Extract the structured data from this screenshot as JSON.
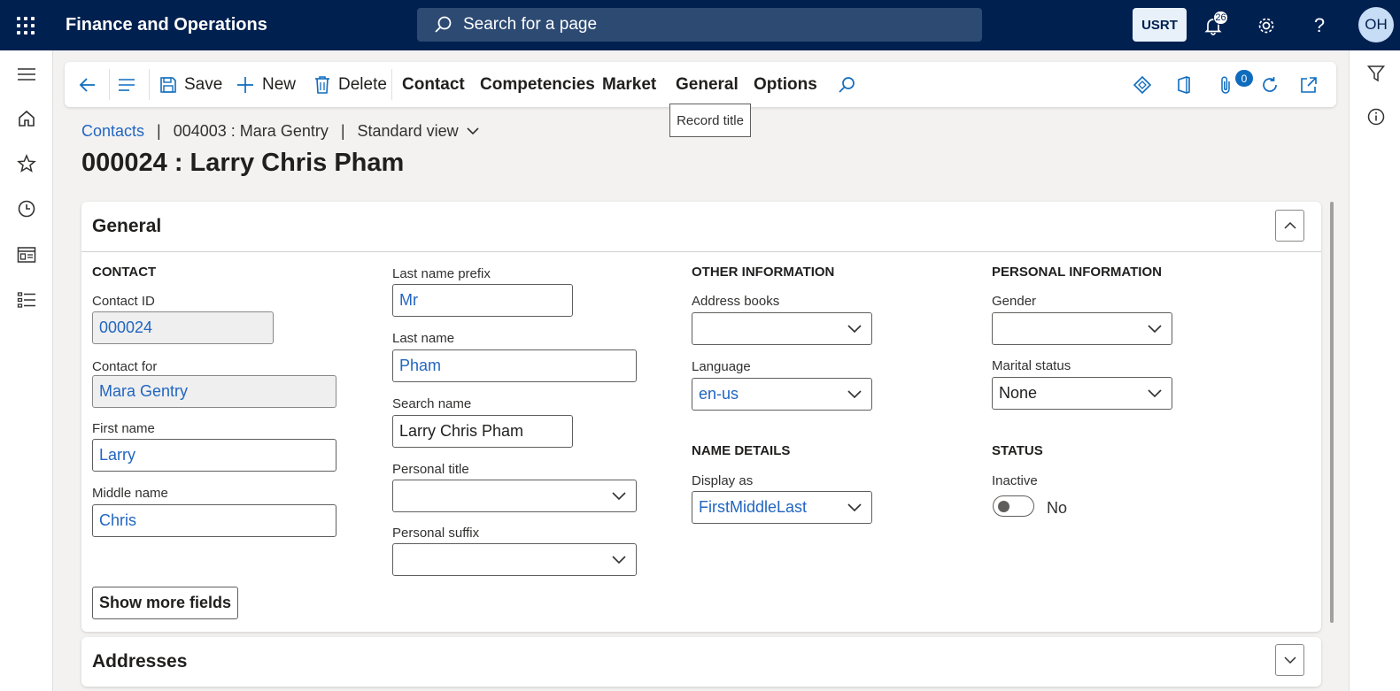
{
  "app": {
    "title": "Finance and Operations"
  },
  "search": {
    "placeholder": "Search for a page"
  },
  "header": {
    "company": "USRT",
    "notifications_count": "26",
    "avatar_initials": "OH"
  },
  "actionpane": {
    "save": "Save",
    "new": "New",
    "delete": "Delete",
    "tabs": [
      "Contact",
      "Competencies",
      "Market",
      "General",
      "Options"
    ],
    "attachments_count": "0"
  },
  "tooltip": "Record title",
  "breadcrumb": {
    "link": "Contacts",
    "record": "004003 : Mara Gentry",
    "view": "Standard view"
  },
  "page_title": "000024 : Larry Chris Pham",
  "general": {
    "title": "General",
    "contact": {
      "heading": "CONTACT",
      "contact_id_label": "Contact ID",
      "contact_id": "000024",
      "contact_for_label": "Contact for",
      "contact_for": "Mara Gentry",
      "first_name_label": "First name",
      "first_name": "Larry",
      "middle_name_label": "Middle name",
      "middle_name": "Chris"
    },
    "names": {
      "last_prefix_label": "Last name prefix",
      "last_prefix": "Mr",
      "last_name_label": "Last name",
      "last_name": "Pham",
      "search_name_label": "Search name",
      "search_name": "Larry Chris Pham",
      "personal_title_label": "Personal title",
      "personal_title": "",
      "personal_suffix_label": "Personal suffix",
      "personal_suffix": ""
    },
    "other": {
      "heading": "OTHER INFORMATION",
      "address_books_label": "Address books",
      "address_books": "",
      "language_label": "Language",
      "language": "en-us"
    },
    "name_details": {
      "heading": "NAME DETAILS",
      "display_as_label": "Display as",
      "display_as": "FirstMiddleLast"
    },
    "personal": {
      "heading": "PERSONAL INFORMATION",
      "gender_label": "Gender",
      "gender": "",
      "marital_label": "Marital status",
      "marital": "None"
    },
    "status": {
      "heading": "STATUS",
      "inactive_label": "Inactive",
      "inactive_value": "No"
    },
    "show_more": "Show more fields"
  },
  "addresses": {
    "title": "Addresses"
  },
  "colors": {
    "nav": "#002050",
    "link": "#2266c0",
    "accent": "#0f6cbd"
  }
}
